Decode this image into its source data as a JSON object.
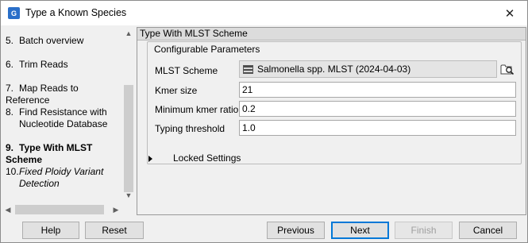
{
  "window": {
    "title": "Type a Known Species",
    "app_icon_text": "G",
    "close_glyph": "✕"
  },
  "steps": [
    {
      "num": "5.",
      "label": "Batch overview"
    },
    {
      "num": "6.",
      "label": "Trim Reads"
    },
    {
      "num": "7.",
      "label": "Map Reads to Reference"
    },
    {
      "num": "8.",
      "label_line1": "Find Resistance with",
      "label_line2": "Nucleotide Database"
    },
    {
      "num": "9.",
      "label": "Type With MLST Scheme"
    },
    {
      "num": "10.",
      "label_line1": "Fixed Ploidy Variant",
      "label_line2": "Detection"
    }
  ],
  "panel": {
    "header": "Type With MLST Scheme",
    "group_title": "Configurable Parameters",
    "fields": {
      "mlst_scheme": {
        "label": "MLST Scheme",
        "value": "Salmonella spp. MLST (2024-04-03)"
      },
      "kmer_size": {
        "label": "Kmer size",
        "value": "21"
      },
      "min_kmer_ratio": {
        "label": "Minimum kmer ratio",
        "value": "0.2"
      },
      "typing_threshold": {
        "label": "Typing threshold",
        "value": "1.0"
      }
    },
    "locked_settings": "Locked Settings"
  },
  "buttons": {
    "help": "Help",
    "reset": "Reset",
    "previous": "Previous",
    "next": "Next",
    "finish": "Finish",
    "cancel": "Cancel"
  },
  "colors": {
    "accent": "#0078d7",
    "background": "#f0f0f0",
    "panel_header": "#dcdcdc"
  }
}
